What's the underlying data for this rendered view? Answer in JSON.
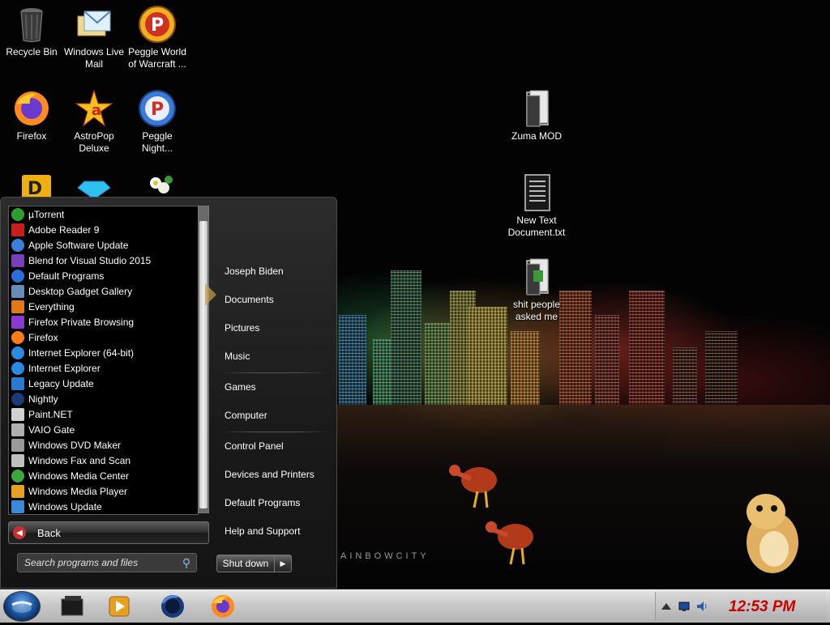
{
  "desktop": {
    "icons": [
      {
        "id": "recycle-bin",
        "label": "Recycle Bin"
      },
      {
        "id": "windows-live-mail",
        "label": "Windows Live Mail"
      },
      {
        "id": "peggle-world-of-warcraft",
        "label": "Peggle World of Warcraft ..."
      },
      {
        "id": "firefox",
        "label": "Firefox"
      },
      {
        "id": "astropop-deluxe",
        "label": "AstroPop Deluxe"
      },
      {
        "id": "peggle-nights",
        "label": "Peggle Night..."
      },
      {
        "id": "zuma-mod",
        "label": "Zuma MOD"
      },
      {
        "id": "new-text-document",
        "label": "New Text Document.txt"
      },
      {
        "id": "folder-asked",
        "label": "shit people asked me"
      }
    ],
    "wallpaper_text": "AINBOWCITY"
  },
  "start_menu": {
    "programs": [
      {
        "label": "µTorrent",
        "icon": "utorrent-icon",
        "color": "#2e9e2e"
      },
      {
        "label": "Adobe Reader 9",
        "icon": "adobe-reader-icon",
        "color": "#c81e1e"
      },
      {
        "label": "Apple Software Update",
        "icon": "apple-update-icon",
        "color": "#3a7fd8"
      },
      {
        "label": "Blend for Visual Studio 2015",
        "icon": "blend-icon",
        "color": "#7a3fb8"
      },
      {
        "label": "Default Programs",
        "icon": "default-programs-icon",
        "color": "#2a6fd8"
      },
      {
        "label": "Desktop Gadget Gallery",
        "icon": "gadget-gallery-icon",
        "color": "#6a8ab8"
      },
      {
        "label": "Everything",
        "icon": "everything-icon",
        "color": "#e07a18"
      },
      {
        "label": "Firefox Private Browsing",
        "icon": "firefox-private-icon",
        "color": "#8a3ad0"
      },
      {
        "label": "Firefox",
        "icon": "firefox-icon",
        "color": "#ff7a18"
      },
      {
        "label": "Internet Explorer (64-bit)",
        "icon": "ie64-icon",
        "color": "#2a8ae0"
      },
      {
        "label": "Internet Explorer",
        "icon": "ie-icon",
        "color": "#2a8ae0"
      },
      {
        "label": "Legacy Update",
        "icon": "legacy-update-icon",
        "color": "#2a7ad0"
      },
      {
        "label": "Nightly",
        "icon": "nightly-icon",
        "color": "#1a3a78"
      },
      {
        "label": "Paint.NET",
        "icon": "paintnet-icon",
        "color": "#d0d0d0"
      },
      {
        "label": "VAIO Gate",
        "icon": "vaio-gate-icon",
        "color": "#b0b0b0"
      },
      {
        "label": "Windows DVD Maker",
        "icon": "dvd-maker-icon",
        "color": "#9a9a9a"
      },
      {
        "label": "Windows Fax and Scan",
        "icon": "fax-scan-icon",
        "color": "#c0c0c0"
      },
      {
        "label": "Windows Media Center",
        "icon": "media-center-icon",
        "color": "#3aa83a"
      },
      {
        "label": "Windows Media Player",
        "icon": "media-player-icon",
        "color": "#e8a020"
      },
      {
        "label": "Windows Update",
        "icon": "windows-update-icon",
        "color": "#3a8ad8"
      }
    ],
    "back_label": "Back",
    "search_placeholder": "Search programs and files",
    "right_links": [
      "Joseph Biden",
      "Documents",
      "Pictures",
      "Music",
      "Games",
      "Computer",
      "Control Panel",
      "Devices and Printers",
      "Default Programs",
      "Help and Support"
    ],
    "shutdown_label": "Shut down"
  },
  "taskbar": {
    "clock": "12:53 PM",
    "pinned": [
      "explorer-icon",
      "media-player-icon",
      "nightly-icon",
      "firefox-icon"
    ]
  }
}
